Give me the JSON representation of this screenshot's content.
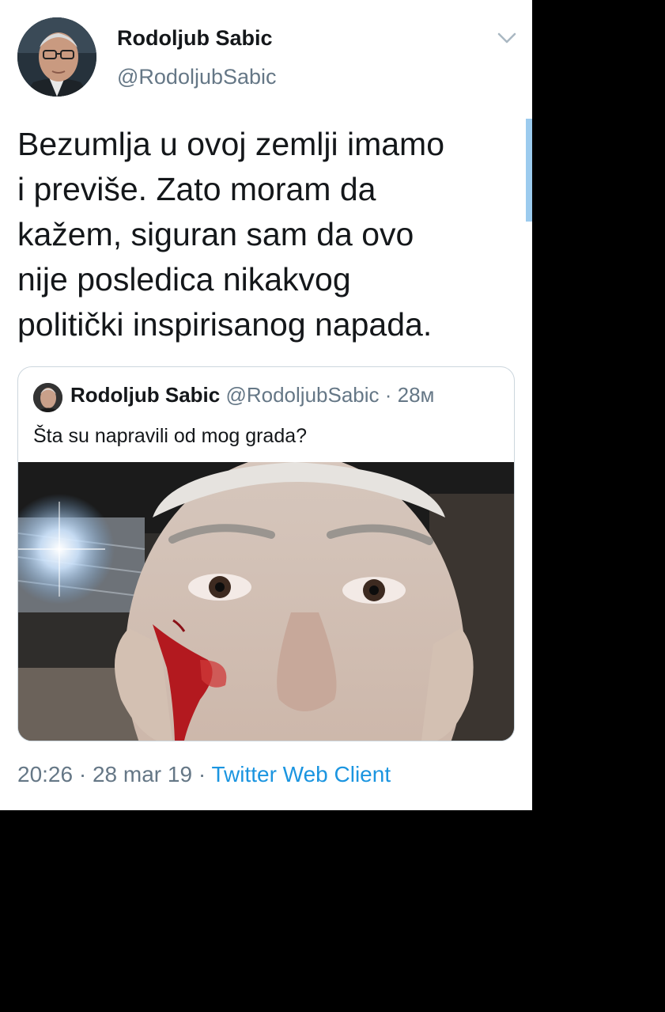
{
  "tweet": {
    "author": {
      "display_name": "Rodoljub Sabic",
      "handle": "@RodoljubSabic"
    },
    "text": "Bezumlja u ovoj zemlji imamo\ni previše. Zato moram da\nkažem, siguran sam da ovo\nnije posledica nikakvog\npolitički inspirisanog napada.",
    "quoted_tweet": {
      "display_name": "Rodoljub Sabic",
      "handle": "@RodoljubSabic",
      "separator": " · ",
      "time_ago": "28м",
      "text": "Šta su napravili od mog grada?"
    },
    "footer": {
      "time": "20:26",
      "sep1": " · ",
      "date": "28 mar 19",
      "sep2": " · ",
      "client": "Twitter Web Client"
    }
  },
  "icons": {
    "menu": "chevron-down-icon"
  },
  "colors": {
    "background": "#ffffff",
    "text": "#14171a",
    "secondary_text": "#657786",
    "link": "#1b95e0",
    "border": "#ccd6dd",
    "scroll_indicator": "#9ccbee"
  }
}
